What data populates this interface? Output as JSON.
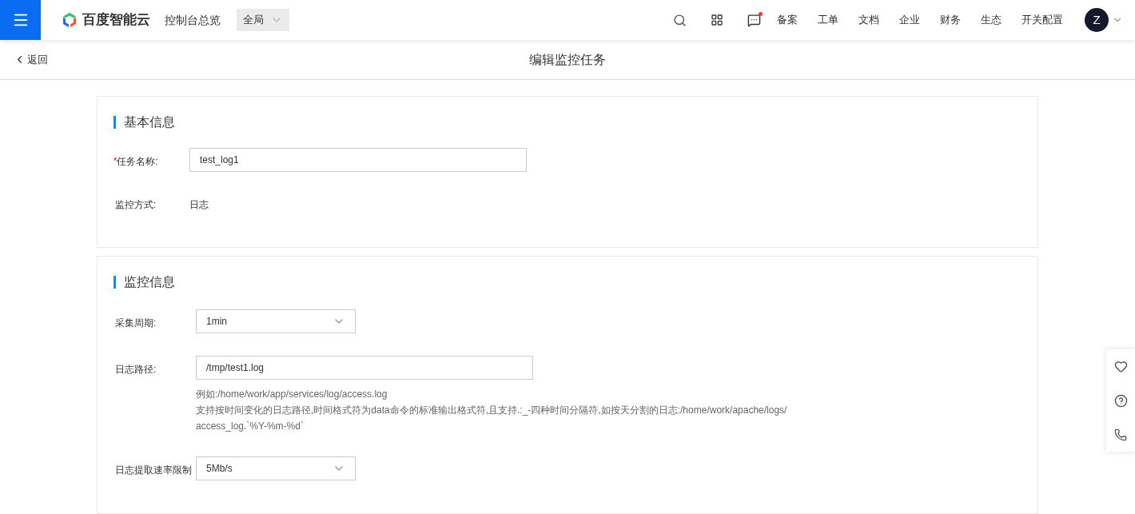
{
  "topbar": {
    "brand": "百度智能云",
    "console": "控制台总览",
    "region": "全局",
    "message_unread": true,
    "links": [
      "备案",
      "工单",
      "文档",
      "企业",
      "财务",
      "生态",
      "开关配置"
    ],
    "avatar": "Z"
  },
  "subheader": {
    "back": "返回",
    "title": "编辑监控任务"
  },
  "sections": [
    {
      "title": "基本信息",
      "fields": [
        {
          "kind": "input",
          "marker": "*",
          "label": "任务名称:",
          "value": "test_log1"
        },
        {
          "kind": "text",
          "label": "监控方式:",
          "value": "日志"
        }
      ]
    },
    {
      "title": "监控信息",
      "fields": [
        {
          "kind": "select",
          "label": "采集周期:",
          "value": "1min"
        },
        {
          "kind": "input",
          "label": "日志路径:",
          "value": "/tmp/test1.log",
          "hints": [
            "例如:/home/work/app/services/log/access.log",
            "支持按时间变化的日志路径,时间格式符为data命令的标准输出格式符,且支持.:_-四种时间分隔符,如按天分割的日志:/home/work/apache/logs/",
            "access_log.`%Y-%m-%d`"
          ]
        },
        {
          "kind": "select",
          "label": "日志提取速率限制",
          "value": "5Mb/s"
        }
      ]
    }
  ]
}
